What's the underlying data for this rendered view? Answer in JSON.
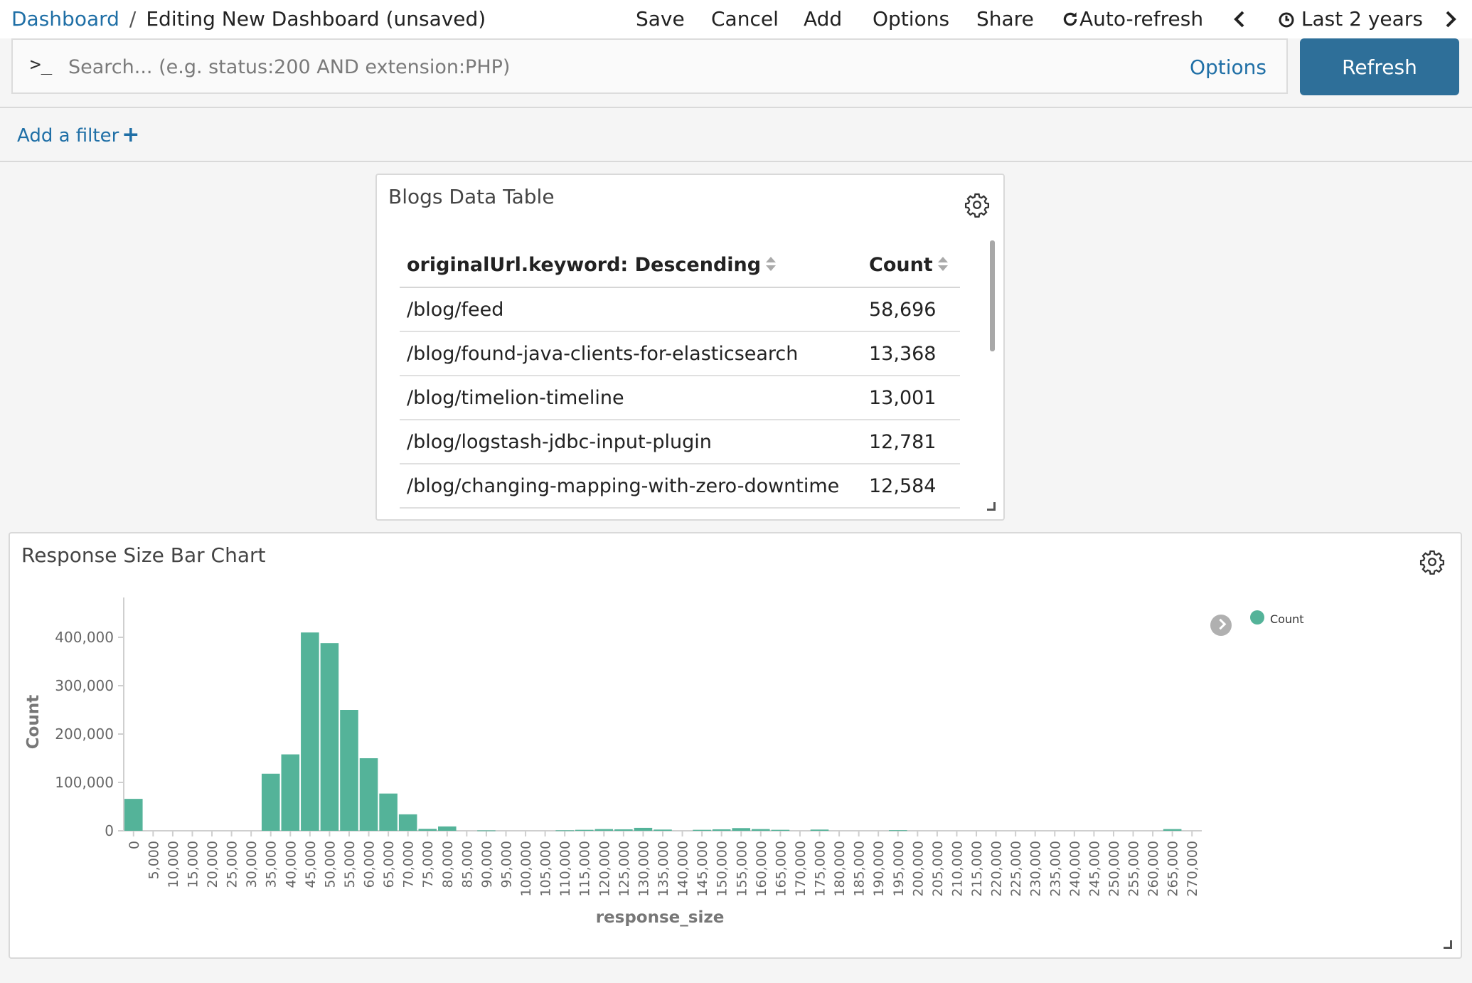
{
  "breadcrumb": {
    "root": "Dashboard",
    "separator": "/",
    "current": "Editing New Dashboard (unsaved)"
  },
  "nav": {
    "save": "Save",
    "cancel": "Cancel",
    "add": "Add",
    "options": "Options",
    "share": "Share",
    "auto_refresh": "Auto-refresh",
    "time_range": "Last 2 years"
  },
  "query": {
    "prompt": ">_",
    "placeholder": "Search... (e.g. status:200 AND extension:PHP)",
    "value": "",
    "options_label": "Options",
    "refresh_label": "Refresh"
  },
  "filter": {
    "add_label": "Add a filter"
  },
  "table_panel": {
    "title": "Blogs Data Table",
    "columns": [
      "originalUrl.keyword: Descending",
      "Count"
    ],
    "rows": [
      [
        "/blog/feed",
        "58,696"
      ],
      [
        "/blog/found-java-clients-for-elasticsearch",
        "13,368"
      ],
      [
        "/blog/timelion-timeline",
        "13,001"
      ],
      [
        "/blog/logstash-jdbc-input-plugin",
        "12,781"
      ],
      [
        "/blog/changing-mapping-with-zero-downtime",
        "12,584"
      ]
    ]
  },
  "chart_panel": {
    "title": "Response Size Bar Chart"
  },
  "colors": {
    "bar": "#54b399",
    "accent": "#1f6fa6",
    "refresh_bg": "#2e6f99"
  },
  "icons": {
    "refresh": "refresh-icon",
    "prev": "chevron-left-icon",
    "clock": "clock-icon",
    "next": "chevron-right-icon",
    "gear": "gear-icon",
    "sort": "sort-icon",
    "plus": "plus-icon"
  },
  "chart_data": {
    "type": "bar",
    "title": "",
    "xlabel": "response_size",
    "ylabel": "Count",
    "ylim": [
      0,
      450000
    ],
    "yticks": [
      0,
      100000,
      200000,
      300000,
      400000
    ],
    "ytick_labels": [
      "0",
      "100,000",
      "200,000",
      "300,000",
      "400,000"
    ],
    "xlim": [
      0,
      275000
    ],
    "bin_width": 5000,
    "x_ticks": [
      "0",
      "5,000",
      "10,000",
      "15,000",
      "20,000",
      "25,000",
      "30,000",
      "35,000",
      "40,000",
      "45,000",
      "50,000",
      "55,000",
      "60,000",
      "65,000",
      "70,000",
      "75,000",
      "80,000",
      "85,000",
      "90,000",
      "95,000",
      "100,000",
      "105,000",
      "110,000",
      "115,000",
      "120,000",
      "125,000",
      "130,000",
      "135,000",
      "140,000",
      "145,000",
      "150,000",
      "155,000",
      "160,000",
      "165,000",
      "170,000",
      "175,000",
      "180,000",
      "185,000",
      "190,000",
      "195,000",
      "200,000",
      "205,000",
      "210,000",
      "215,000",
      "220,000",
      "225,000",
      "230,000",
      "235,000",
      "240,000",
      "245,000",
      "250,000",
      "255,000",
      "260,000",
      "265,000",
      "270,000"
    ],
    "x": [
      0,
      35000,
      40000,
      45000,
      50000,
      55000,
      60000,
      65000,
      70000,
      75000,
      80000,
      90000,
      110000,
      115000,
      120000,
      125000,
      130000,
      135000,
      145000,
      150000,
      155000,
      160000,
      165000,
      175000,
      195000,
      265000
    ],
    "series": [
      {
        "name": "Count",
        "values": [
          66000,
          118000,
          158000,
          410000,
          388000,
          250000,
          150000,
          77000,
          34000,
          4000,
          9000,
          800,
          1000,
          2000,
          3500,
          3000,
          6000,
          2500,
          2000,
          3000,
          5500,
          3500,
          2000,
          2500,
          1200,
          3500
        ]
      }
    ],
    "legend": "top-right",
    "grid": false
  }
}
